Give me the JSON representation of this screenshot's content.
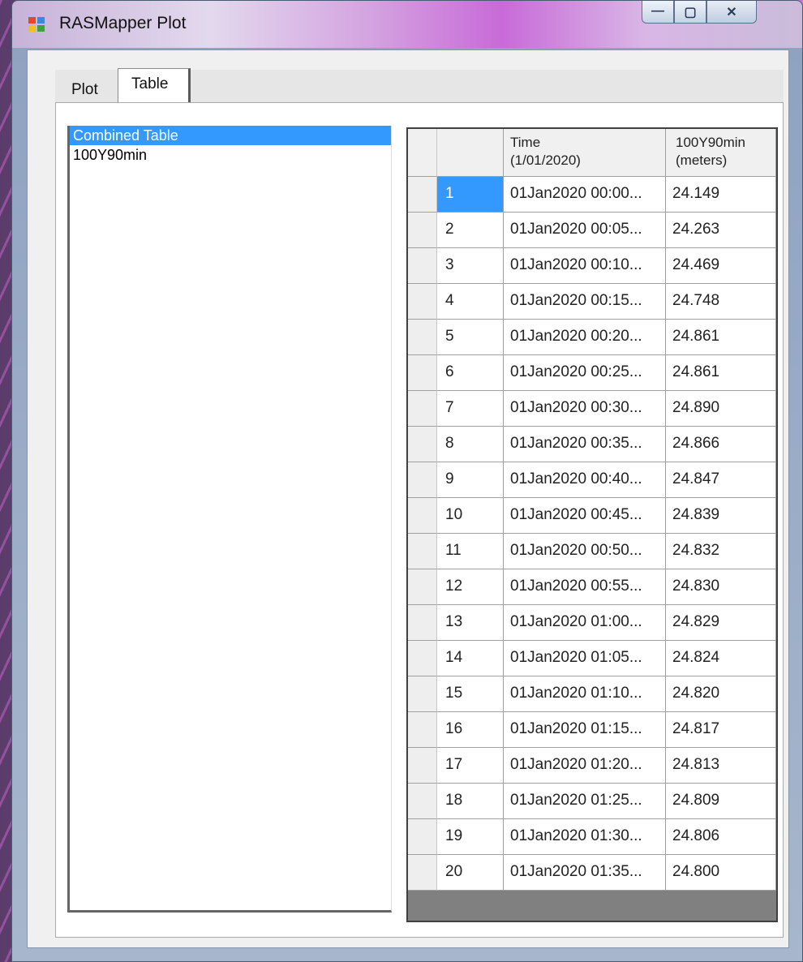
{
  "window": {
    "title": "RASMapper Plot"
  },
  "window_controls": {
    "minimize": "—",
    "maximize": "▢",
    "close": "✕"
  },
  "tabs": [
    {
      "label": "Plot"
    },
    {
      "label": "Table"
    }
  ],
  "list": {
    "items": [
      "Combined Table",
      "100Y90min"
    ],
    "selected": 0
  },
  "table": {
    "headers": [
      "",
      "Time\n(1/01/2020)",
      "100Y90min\n(meters)"
    ],
    "header_time_line1": "Time",
    "header_time_line2": "(1/01/2020)",
    "header_val_line1": "100Y90min",
    "header_val_line2": "(meters)",
    "rows": [
      {
        "n": "1",
        "time": "01Jan2020 00:00...",
        "value": "24.149"
      },
      {
        "n": "2",
        "time": "01Jan2020 00:05...",
        "value": "24.263"
      },
      {
        "n": "3",
        "time": "01Jan2020 00:10...",
        "value": "24.469"
      },
      {
        "n": "4",
        "time": "01Jan2020 00:15...",
        "value": "24.748"
      },
      {
        "n": "5",
        "time": "01Jan2020 00:20...",
        "value": "24.861"
      },
      {
        "n": "6",
        "time": "01Jan2020 00:25...",
        "value": "24.861"
      },
      {
        "n": "7",
        "time": "01Jan2020 00:30...",
        "value": "24.890"
      },
      {
        "n": "8",
        "time": "01Jan2020 00:35...",
        "value": "24.866"
      },
      {
        "n": "9",
        "time": "01Jan2020 00:40...",
        "value": "24.847"
      },
      {
        "n": "10",
        "time": "01Jan2020 00:45...",
        "value": "24.839"
      },
      {
        "n": "11",
        "time": "01Jan2020 00:50...",
        "value": "24.832"
      },
      {
        "n": "12",
        "time": "01Jan2020 00:55...",
        "value": "24.830"
      },
      {
        "n": "13",
        "time": "01Jan2020 01:00...",
        "value": "24.829"
      },
      {
        "n": "14",
        "time": "01Jan2020 01:05...",
        "value": "24.824"
      },
      {
        "n": "15",
        "time": "01Jan2020 01:10...",
        "value": "24.820"
      },
      {
        "n": "16",
        "time": "01Jan2020 01:15...",
        "value": "24.817"
      },
      {
        "n": "17",
        "time": "01Jan2020 01:20...",
        "value": "24.813"
      },
      {
        "n": "18",
        "time": "01Jan2020 01:25...",
        "value": "24.809"
      },
      {
        "n": "19",
        "time": "01Jan2020 01:30...",
        "value": "24.806"
      },
      {
        "n": "20",
        "time": "01Jan2020 01:35...",
        "value": "24.800"
      }
    ]
  }
}
